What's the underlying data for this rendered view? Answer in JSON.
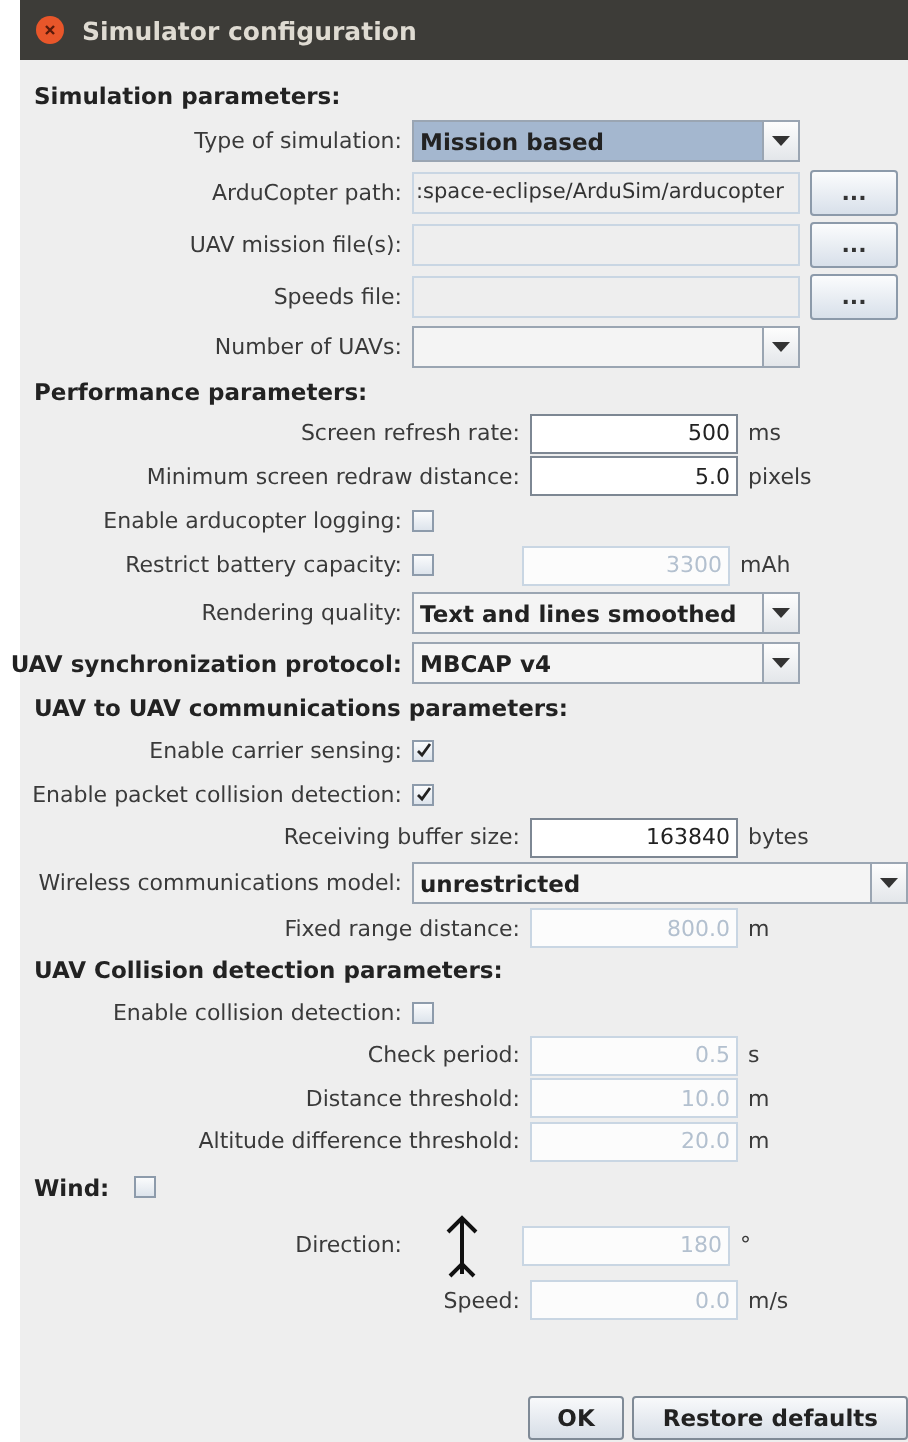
{
  "window": {
    "title": "Simulator configuration"
  },
  "rows": [
    {
      "kind": "heading",
      "text": "Simulation parameters:"
    },
    {
      "kind": "combo",
      "label": "Type of simulation:",
      "value": "Mission based",
      "focused": true
    },
    {
      "kind": "path",
      "label": "ArduCopter path:",
      "value": ":space-eclipse/ArduSim/arducopter",
      "button": "..."
    },
    {
      "kind": "path",
      "label": "UAV mission file(s):",
      "button": "..."
    },
    {
      "kind": "path",
      "label": "Speeds file:",
      "button": "..."
    },
    {
      "kind": "combo",
      "label": "Number of UAVs:",
      "focused": false
    },
    {
      "kind": "heading",
      "text": "Performance parameters:"
    },
    {
      "kind": "number",
      "label": "Screen refresh rate:",
      "value": "500",
      "unit": "ms",
      "disabled": false
    },
    {
      "kind": "number",
      "label": "Minimum screen redraw distance:",
      "value": "5.0",
      "unit": "pixels",
      "disabled": false
    },
    {
      "kind": "check",
      "label": "Enable arducopter logging:",
      "checked": false
    },
    {
      "kind": "check_number",
      "label": "Restrict battery capacity:",
      "checked": false,
      "value": "3300",
      "unit": "mAh",
      "disabled": true
    },
    {
      "kind": "combo",
      "label": "Rendering quality:",
      "value": "Text and lines smoothed",
      "focused": false
    },
    {
      "kind": "bold_combo",
      "label": "UAV synchronization protocol:",
      "value": "MBCAP v4",
      "focused": false
    },
    {
      "kind": "heading",
      "text": "UAV to UAV communications parameters:"
    },
    {
      "kind": "check",
      "label": "Enable carrier sensing:",
      "checked": true
    },
    {
      "kind": "check",
      "label": "Enable packet collision detection:",
      "checked": true
    },
    {
      "kind": "number",
      "label": "Receiving buffer size:",
      "value": "163840",
      "unit": "bytes",
      "disabled": false
    },
    {
      "kind": "wide_combo",
      "label": "Wireless communications model:",
      "value": "unrestricted",
      "focused": false
    },
    {
      "kind": "number",
      "label": "Fixed range distance:",
      "value": "800.0",
      "unit": "m",
      "disabled": true
    },
    {
      "kind": "heading",
      "text": "UAV Collision detection parameters:"
    },
    {
      "kind": "check",
      "label": "Enable collision detection:",
      "checked": false
    },
    {
      "kind": "number",
      "label": "Check period:",
      "value": "0.5",
      "unit": "s",
      "disabled": true
    },
    {
      "kind": "number",
      "label": "Distance threshold:",
      "value": "10.0",
      "unit": "m",
      "disabled": true
    },
    {
      "kind": "number",
      "label": "Altitude difference threshold:",
      "value": "20.0",
      "unit": "m",
      "disabled": true
    },
    {
      "kind": "bold_check",
      "label": "Wind:",
      "checked": false
    },
    {
      "kind": "direction",
      "label": "Direction:",
      "value": "180",
      "unit": "°",
      "disabled": true
    },
    {
      "kind": "number",
      "label": "Speed:",
      "value": "0.0",
      "unit": "m/s",
      "disabled": true
    }
  ],
  "buttons": [
    {
      "label": "OK"
    },
    {
      "label": "Restore defaults"
    }
  ]
}
